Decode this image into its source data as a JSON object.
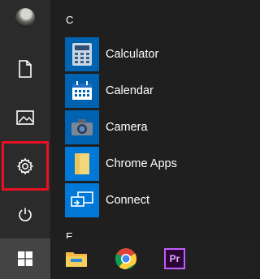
{
  "start_menu": {
    "rail": {
      "items": [
        {
          "icon": "user-avatar"
        },
        {
          "icon": "document-icon"
        },
        {
          "icon": "pictures-icon"
        },
        {
          "icon": "gear-icon",
          "highlighted": true
        },
        {
          "icon": "power-icon"
        }
      ]
    },
    "app_list": {
      "section_letter": "C",
      "next_letter": "E",
      "apps": [
        {
          "label": "Calculator",
          "tile_color": "#0063b1"
        },
        {
          "label": "Calendar",
          "tile_color": "#0063b1"
        },
        {
          "label": "Camera",
          "tile_color": "#0063b1"
        },
        {
          "label": "Chrome Apps",
          "tile_color": "#0078d7"
        },
        {
          "label": "Connect",
          "tile_color": "#0078d7"
        }
      ]
    }
  },
  "taskbar": {
    "items": [
      {
        "icon": "windows-start-icon",
        "active": true
      },
      {
        "icon": "file-explorer-icon"
      },
      {
        "icon": "chrome-icon"
      },
      {
        "icon": "premiere-pro-icon",
        "text": "Pr"
      }
    ]
  },
  "colors": {
    "highlight_border": "#e81123",
    "tile_blue": "#0063b1"
  }
}
